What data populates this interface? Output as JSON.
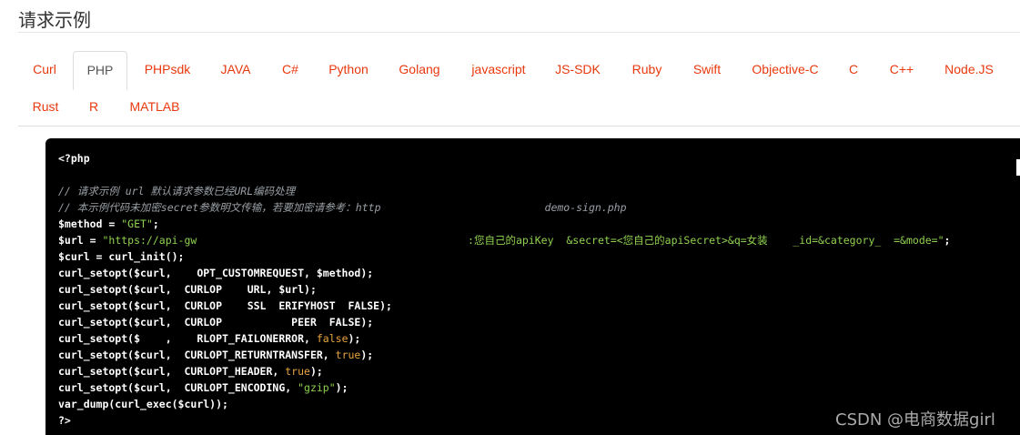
{
  "header": {
    "title": "请求示例"
  },
  "tabs": [
    {
      "label": "Curl",
      "active": false
    },
    {
      "label": "PHP",
      "active": true
    },
    {
      "label": "PHPsdk",
      "active": false
    },
    {
      "label": "JAVA",
      "active": false
    },
    {
      "label": "C#",
      "active": false
    },
    {
      "label": "Python",
      "active": false
    },
    {
      "label": "Golang",
      "active": false
    },
    {
      "label": "javascript",
      "active": false
    },
    {
      "label": "JS-SDK",
      "active": false
    },
    {
      "label": "Ruby",
      "active": false
    },
    {
      "label": "Swift",
      "active": false
    },
    {
      "label": "Objective-C",
      "active": false
    },
    {
      "label": "C",
      "active": false
    },
    {
      "label": "C++",
      "active": false
    },
    {
      "label": "Node.JS",
      "active": false
    },
    {
      "label": "Rust",
      "active": false
    },
    {
      "label": "R",
      "active": false
    },
    {
      "label": "MATLAB",
      "active": false
    }
  ],
  "code": {
    "lines": [
      [
        {
          "t": "<?php",
          "c": ""
        }
      ],
      [],
      [
        {
          "t": "// 请求示例 url 默认请求参数已经URL编码处理",
          "c": "com"
        }
      ],
      [
        {
          "t": "// 本示例代码未加密secret参数明文传输，若要加密请参考：http                          demo-sign.php",
          "c": "com"
        }
      ],
      [
        {
          "t": "$method = ",
          "c": ""
        },
        {
          "t": "\"GET\"",
          "c": "str"
        },
        {
          "t": ";",
          "c": ""
        }
      ],
      [
        {
          "t": "$url = ",
          "c": ""
        },
        {
          "t": "\"https://api-gw                                           :您自己的apiKey  &secret=<您自己的apiSecret>&q=女装    _id=&category_  =&mode=\"",
          "c": "str"
        },
        {
          "t": ";",
          "c": ""
        }
      ],
      [
        {
          "t": "$curl = curl_init();",
          "c": ""
        }
      ],
      [
        {
          "t": "curl_setopt($curl,    OPT_CUSTOMREQUEST, $method);",
          "c": ""
        }
      ],
      [
        {
          "t": "curl_setopt($curl,  CURLOP    URL, $url);",
          "c": ""
        }
      ],
      [
        {
          "t": "curl_setopt($curl,  CURLOP    SSL  ERIFYHOST  FALSE);",
          "c": ""
        }
      ],
      [
        {
          "t": "curl_setopt($curl,  CURLOP           PEER  FALSE);",
          "c": ""
        }
      ],
      [
        {
          "t": "curl_setopt($    ,    RLOPT_FAILONERROR, ",
          "c": ""
        },
        {
          "t": "false",
          "c": "kw"
        },
        {
          "t": ");",
          "c": ""
        }
      ],
      [
        {
          "t": "curl_setopt($curl,  CURLOPT_RETURNTRANSFER, ",
          "c": ""
        },
        {
          "t": "true",
          "c": "kw"
        },
        {
          "t": ");",
          "c": ""
        }
      ],
      [
        {
          "t": "curl_setopt($curl,  CURLOPT_HEADER, ",
          "c": ""
        },
        {
          "t": "true",
          "c": "kw"
        },
        {
          "t": ");",
          "c": ""
        }
      ],
      [
        {
          "t": "curl_setopt($curl,  CURLOPT_ENCODING, ",
          "c": ""
        },
        {
          "t": "\"gzip\"",
          "c": "str"
        },
        {
          "t": ");",
          "c": ""
        }
      ],
      [
        {
          "t": "var_dump(curl_exec($curl));",
          "c": ""
        }
      ],
      [
        {
          "t": "?>",
          "c": ""
        }
      ]
    ]
  },
  "watermark": "CSDN @电商数据girl",
  "colors": {
    "tab_link": "#e8380d",
    "code_bg": "#000000",
    "string": "#8fd14f",
    "keyword": "#e8a33d",
    "comment": "#9aa0a6"
  }
}
